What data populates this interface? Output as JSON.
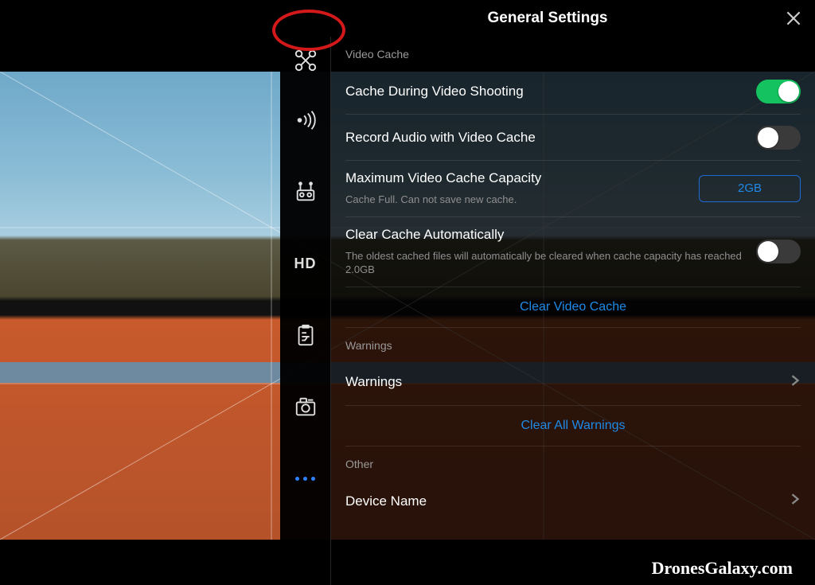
{
  "header": {
    "title": "General Settings"
  },
  "section": {
    "video_cache_label": "Video Cache",
    "warnings_label": "Warnings",
    "other_label": "Other"
  },
  "rows": {
    "cache_shooting": {
      "label": "Cache During Video Shooting",
      "on": true
    },
    "record_audio": {
      "label": "Record Audio with Video Cache",
      "on": false
    },
    "max_capacity": {
      "label": "Maximum Video Cache Capacity",
      "value": "2GB",
      "sub": "Cache Full. Can not save new cache."
    },
    "clear_auto": {
      "label": "Clear Cache Automatically",
      "on": false,
      "sub": "The oldest cached files will automatically be cleared when cache capacity has reached 2.0GB"
    },
    "clear_video_cache": "Clear Video Cache",
    "warnings": {
      "label": "Warnings"
    },
    "clear_all_warnings": "Clear All Warnings",
    "device_name": {
      "label": "Device Name"
    }
  },
  "sidebar": {
    "hd": "HD"
  },
  "watermark": "DronesGalaxy.com"
}
